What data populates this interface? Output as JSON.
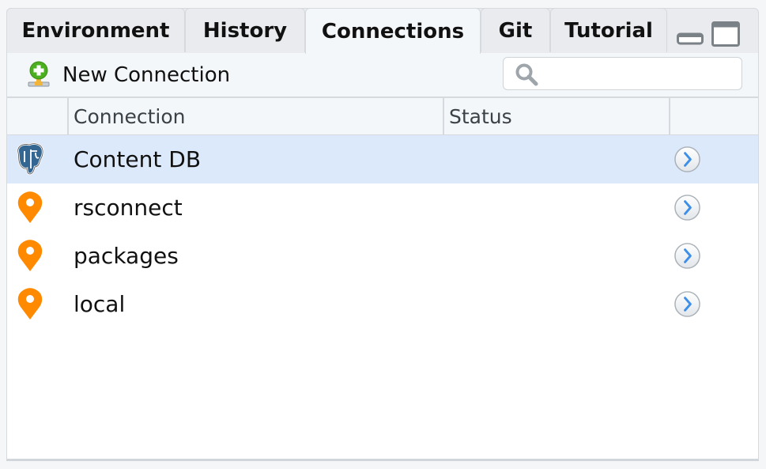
{
  "tabs": [
    {
      "label": "Environment",
      "active": false
    },
    {
      "label": "History",
      "active": false
    },
    {
      "label": "Connections",
      "active": true
    },
    {
      "label": "Git",
      "active": false
    },
    {
      "label": "Tutorial",
      "active": false
    }
  ],
  "window_controls": {
    "minimize_icon": "minimize-pane-icon",
    "maximize_icon": "maximize-pane-icon"
  },
  "toolbar": {
    "new_connection_label": "New Connection",
    "new_connection_icon": "add-connection-icon",
    "search": {
      "value": "",
      "placeholder": "",
      "icon": "search-icon"
    }
  },
  "table": {
    "columns": [
      "Connection",
      "Status",
      ""
    ],
    "rows": [
      {
        "name": "Content DB",
        "status": "",
        "icon": "postgresql-elephant-icon",
        "selected": true
      },
      {
        "name": "rsconnect",
        "status": "",
        "icon": "map-pin-icon",
        "selected": false
      },
      {
        "name": "packages",
        "status": "",
        "icon": "map-pin-icon",
        "selected": false
      },
      {
        "name": "local",
        "status": "",
        "icon": "map-pin-icon",
        "selected": false
      }
    ]
  },
  "colors": {
    "selected_row": "#dbe9fb",
    "pin_orange": "#ff8a00",
    "postgres_blue": "#336791",
    "add_green": "#4caf1f",
    "arrow_blue": "#3d8fe8"
  }
}
